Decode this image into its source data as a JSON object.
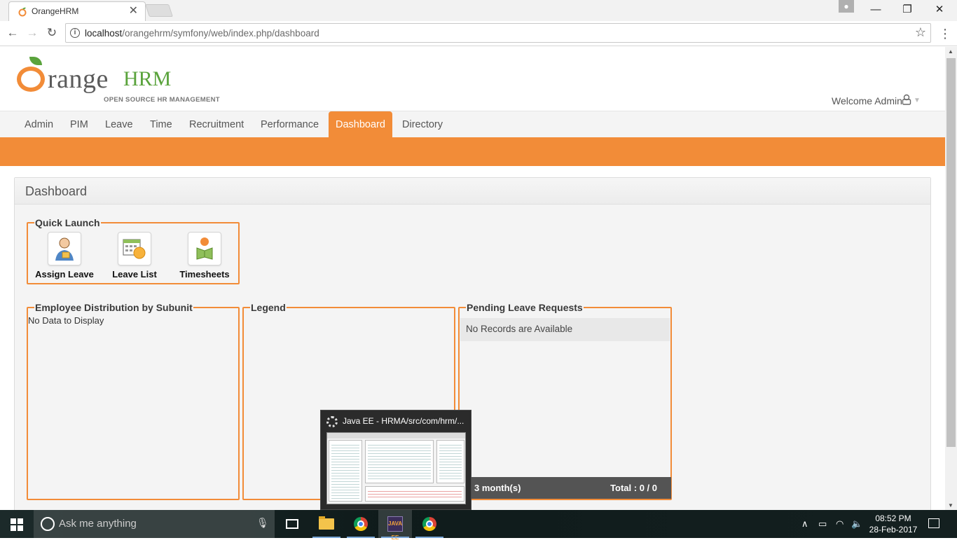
{
  "browser": {
    "tab_title": "OrangeHRM",
    "tab_close": "✕",
    "url_host": "localhost",
    "url_path": "/orangehrm/symfony/web/index.php/dashboard",
    "back": "←",
    "forward": "→",
    "reload": "↻",
    "star": "☆",
    "menu": "⋮",
    "win_min": "—",
    "win_restore": "❐",
    "win_close": "✕"
  },
  "header": {
    "logo_word": "range",
    "logo_hrm": "HRM",
    "logo_tagline": "OPEN SOURCE HR MANAGEMENT",
    "welcome": "Welcome Admin",
    "caret": "▼"
  },
  "menu": {
    "items": [
      {
        "label": "Admin"
      },
      {
        "label": "PIM"
      },
      {
        "label": "Leave"
      },
      {
        "label": "Time"
      },
      {
        "label": "Recruitment"
      },
      {
        "label": "Performance"
      },
      {
        "label": "Dashboard",
        "active": true
      },
      {
        "label": "Directory"
      }
    ]
  },
  "dashboard": {
    "title": "Dashboard",
    "quick_launch": {
      "legend": "Quick Launch",
      "items": [
        {
          "label": "Assign Leave",
          "icon": "assign-leave-icon"
        },
        {
          "label": "Leave List",
          "icon": "leave-list-icon"
        },
        {
          "label": "Timesheets",
          "icon": "timesheets-icon"
        }
      ]
    },
    "employee_distribution": {
      "legend": "Employee Distribution by Subunit",
      "empty": "No Data to Display"
    },
    "legend_panel": {
      "legend": "Legend"
    },
    "pending_leave": {
      "legend": "Pending Leave Requests",
      "empty": "No Records are Available",
      "footer_period": "3 month(s)",
      "footer_total": "Total : 0 / 0"
    }
  },
  "thumbnail": {
    "title": "Java EE - HRMA/src/com/hrm/..."
  },
  "taskbar": {
    "search_placeholder": "Ask me anything",
    "eclipse_label": "JAVA EE",
    "time": "08:52 PM",
    "date": "28-Feb-2017"
  },
  "colors": {
    "accent": "#f28c38",
    "logo_green": "#5aa33c"
  }
}
